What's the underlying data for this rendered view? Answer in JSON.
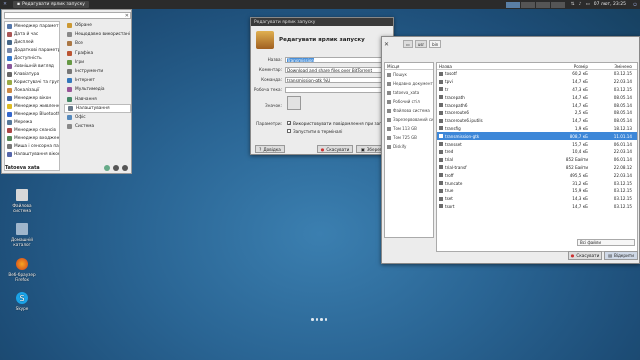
{
  "topbar": {
    "active_task": "Редагувати ярлик запуску",
    "workspaces": [
      "",
      "",
      "",
      ""
    ],
    "clock": "07 лют, 23:25"
  },
  "menu": {
    "favorites": [
      {
        "label": "Менеджер параметрі",
        "color": "#5577aa"
      },
      {
        "label": "Дата й час",
        "color": "#aa5555"
      },
      {
        "label": "Дисплей",
        "color": "#446688"
      },
      {
        "label": "Додаткові параметри",
        "color": "#7788aa"
      },
      {
        "label": "Доступність",
        "color": "#3377cc"
      },
      {
        "label": "Зовнішній вигляд",
        "color": "#885599"
      },
      {
        "label": "Клавіатура",
        "color": "#666666"
      },
      {
        "label": "Користувачі та групи",
        "color": "#99aa44"
      },
      {
        "label": "Локалізації",
        "color": "#cc8844"
      },
      {
        "label": "Менеджер вікон",
        "color": "#4466aa"
      },
      {
        "label": "Менеджер живлення",
        "color": "#ddbb22"
      },
      {
        "label": "Менеджер Bluetooth",
        "color": "#3366cc"
      },
      {
        "label": "Мережа",
        "color": "#557799"
      },
      {
        "label": "Менеджер сеансів",
        "color": "#aa4444"
      },
      {
        "label": "Менеджер входження",
        "color": "#558855"
      },
      {
        "label": "Миша і сенсорна панель",
        "color": "#777777"
      },
      {
        "label": "Налаштування вікон",
        "color": "#5566aa"
      }
    ],
    "categories": [
      {
        "label": "Обране",
        "color": "#cc9933"
      },
      {
        "label": "Нещодавно використані",
        "color": "#888888"
      },
      {
        "label": "Все",
        "color": "#aa7744"
      },
      {
        "label": "Графіка",
        "color": "#bb5533"
      },
      {
        "label": "Ігри",
        "color": "#669944"
      },
      {
        "label": "Інструменти",
        "color": "#777777"
      },
      {
        "label": "Інтернет",
        "color": "#3377bb"
      },
      {
        "label": "Мультимедіа",
        "color": "#995599"
      },
      {
        "label": "Навчання",
        "color": "#448866"
      },
      {
        "label": "Налаштування",
        "color": "#667788"
      },
      {
        "label": "Офіс",
        "color": "#5588bb"
      },
      {
        "label": "Система",
        "color": "#888888"
      }
    ],
    "highlighted_category": 9,
    "user": "Tatoeva xata"
  },
  "desktop_icons": [
    {
      "label": "Файлова система"
    },
    {
      "label": "Домашній каталог"
    },
    {
      "label": "Веб-браузер Firefox"
    },
    {
      "label": "Skype"
    }
  ],
  "dialog": {
    "title": "Редагувати ярлик запуску",
    "heading": "Редагувати ярлик запуску",
    "name_label": "Назва:",
    "name_value": "Transmission",
    "comment_label": "Коментар:",
    "comment_value": "Download and share files over BitTorrent",
    "command_label": "Команда:",
    "command_value": "transmission-gtk %U",
    "workdir_label": "Робоча тека:",
    "workdir_value": "",
    "icon_label": "Значок:",
    "params_label": "Параметри:",
    "opt_notify": "Використовувати повідомлення при запуску",
    "opt_terminal": "Запустити в терміналі",
    "help_label": "Довідка",
    "cancel_label": "Скасувати",
    "save_label": "Зберегти"
  },
  "filechooser": {
    "path_buttons": [
      "",
      "usr",
      "bin"
    ],
    "places_header": "Місця",
    "places": [
      "Пошук",
      "Недавно документи",
      "tatoeva_xata",
      "Робочий стіл",
      "Файлова система",
      "Зарезервований системою",
      "Том 113 GB",
      "Том 725 GB",
      "Diskify"
    ],
    "col_name": "Назва",
    "col_size": "Розмір",
    "col_modified": "Змінено",
    "files": [
      {
        "name": "tosotf",
        "size": "60,2 кБ",
        "date": "03.12.15"
      },
      {
        "name": "tpvi",
        "size": "14,7 кБ",
        "date": "22.03.14"
      },
      {
        "name": "tr",
        "size": "47,3 кБ",
        "date": "03.12.15"
      },
      {
        "name": "tracepath",
        "size": "14,7 кБ",
        "date": "08.05.14"
      },
      {
        "name": "tracepath6",
        "size": "14,7 кБ",
        "date": "08.05.14"
      },
      {
        "name": "traceroute6",
        "size": "2,5 кБ",
        "date": "08.05.14"
      },
      {
        "name": "traceroute6.iputils",
        "size": "14,7 кБ",
        "date": "08.05.14"
      },
      {
        "name": "transfig",
        "size": "1,9 кБ",
        "date": "18.12.13"
      },
      {
        "name": "transmission-gtk",
        "size": "808,7 кБ",
        "date": "11.01.14"
      },
      {
        "name": "transset",
        "size": "15,7 кБ",
        "date": "06.01.14"
      },
      {
        "name": "tred",
        "size": "10,4 кБ",
        "date": "22.03.14"
      },
      {
        "name": "trial",
        "size": "852 Байти",
        "date": "06.01.14"
      },
      {
        "name": "trial-transf",
        "size": "852 Байти",
        "date": "22.08.12"
      },
      {
        "name": "troff",
        "size": "495,5 кБ",
        "date": "22.03.14"
      },
      {
        "name": "truncate",
        "size": "31,2 кБ",
        "date": "03.12.15"
      },
      {
        "name": "true",
        "size": "15,9 кБ",
        "date": "03.12.15"
      },
      {
        "name": "tset",
        "size": "14,3 кБ",
        "date": "03.12.15"
      },
      {
        "name": "tsort",
        "size": "14,7 кБ",
        "date": "03.12.15"
      }
    ],
    "selected_index": 8,
    "filter": "Всі файли",
    "cancel_label": "Скасувати",
    "open_label": "Відкрити"
  }
}
